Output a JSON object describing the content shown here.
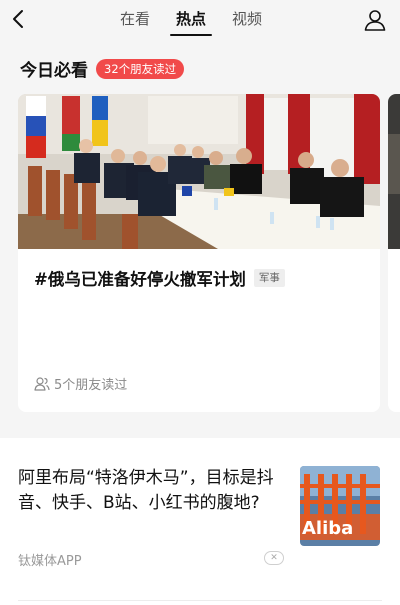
{
  "nav": {
    "tabs": [
      {
        "label": "在看"
      },
      {
        "label": "热点"
      },
      {
        "label": "视频"
      }
    ],
    "active_tab": "热点"
  },
  "section": {
    "title": "今日必看",
    "friends_badge": "32个朋友读过"
  },
  "featured_card": {
    "title": "#俄乌已准备好停火撤军计划",
    "tag": "军事",
    "friends_read": "5个朋友读过"
  },
  "article": {
    "title": "阿里布局“特洛伊木马”，目标是抖音、快手、B站、小红书的腹地?",
    "source": "钛媒体APP",
    "thumbnail_text": "Aliba"
  },
  "colors": {
    "badge_red": "#f14a4a",
    "background": "#f5f5f5",
    "text_primary": "#111111",
    "text_secondary": "#8a8a8a"
  },
  "icons": [
    "back-icon",
    "user-icon",
    "friends-icon",
    "close-icon"
  ]
}
